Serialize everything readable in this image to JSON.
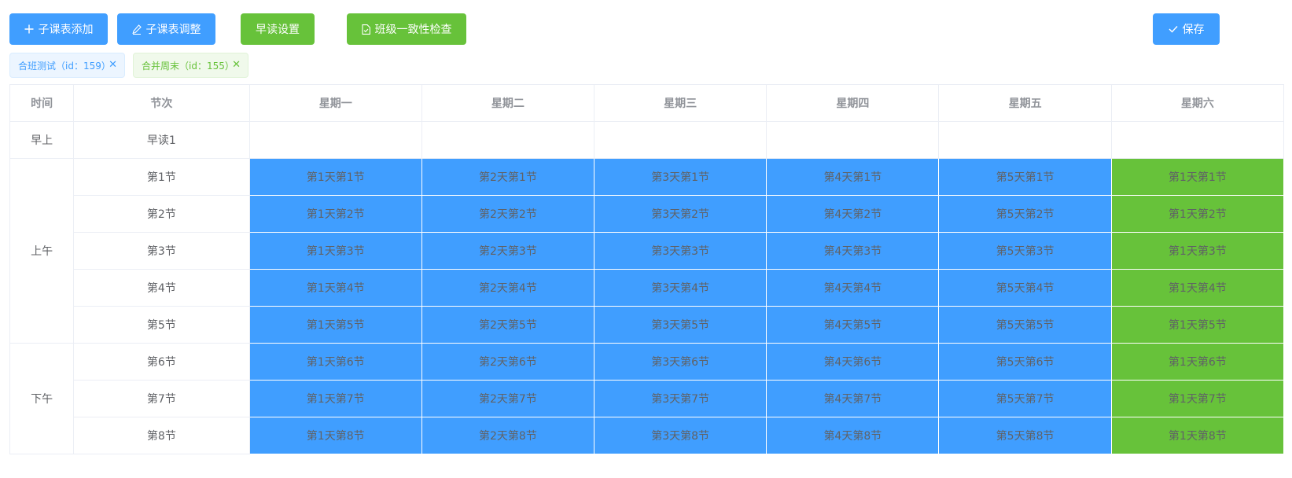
{
  "toolbar": {
    "add_label": "子课表添加",
    "adjust_label": "子课表调整",
    "morning_label": "早读设置",
    "check_label": "班级一致性检查",
    "save_label": "保存",
    "colors": {
      "primary": "#409eff",
      "success": "#67c23a"
    }
  },
  "tags": [
    {
      "label": "合班测试（id：159）",
      "color": "blue"
    },
    {
      "label": "合并周末（id：155）",
      "color": "green"
    }
  ],
  "table": {
    "headers": [
      "时间",
      "节次",
      "星期一",
      "星期二",
      "星期三",
      "星期四",
      "星期五",
      "星期六"
    ],
    "rows": [
      {
        "period": "早上",
        "slot": "早读1",
        "cells": [
          "",
          "",
          "",
          "",
          "",
          ""
        ]
      },
      {
        "period": "上午",
        "slot": "第1节",
        "cells": [
          "第1天第1节",
          "第2天第1节",
          "第3天第1节",
          "第4天第1节",
          "第5天第1节",
          "第1天第1节"
        ]
      },
      {
        "period": "",
        "slot": "第2节",
        "cells": [
          "第1天第2节",
          "第2天第2节",
          "第3天第2节",
          "第4天第2节",
          "第5天第2节",
          "第1天第2节"
        ]
      },
      {
        "period": "",
        "slot": "第3节",
        "cells": [
          "第1天第3节",
          "第2天第3节",
          "第3天第3节",
          "第4天第3节",
          "第5天第3节",
          "第1天第3节"
        ]
      },
      {
        "period": "",
        "slot": "第4节",
        "cells": [
          "第1天第4节",
          "第2天第4节",
          "第3天第4节",
          "第4天第4节",
          "第5天第4节",
          "第1天第4节"
        ]
      },
      {
        "period": "",
        "slot": "第5节",
        "cells": [
          "第1天第5节",
          "第2天第5节",
          "第3天第5节",
          "第4天第5节",
          "第5天第5节",
          "第1天第5节"
        ]
      },
      {
        "period": "下午",
        "slot": "第6节",
        "cells": [
          "第1天第6节",
          "第2天第6节",
          "第3天第6节",
          "第4天第6节",
          "第5天第6节",
          "第1天第6节"
        ]
      },
      {
        "period": "",
        "slot": "第7节",
        "cells": [
          "第1天第7节",
          "第2天第7节",
          "第3天第7节",
          "第4天第7节",
          "第5天第7节",
          "第1天第7节"
        ]
      },
      {
        "period": "",
        "slot": "第8节",
        "cells": [
          "第1天第8节",
          "第2天第8节",
          "第3天第8节",
          "第4天第8节",
          "第5天第8节",
          "第1天第8节"
        ]
      }
    ]
  }
}
